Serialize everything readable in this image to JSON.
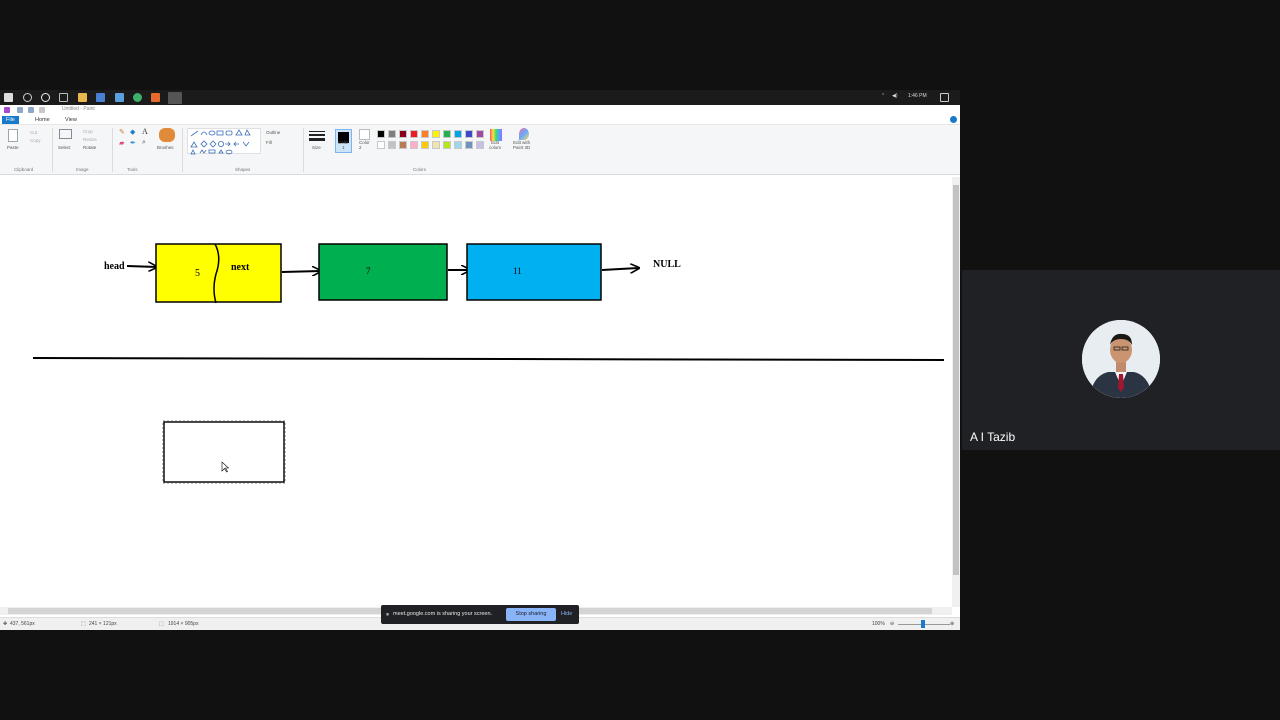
{
  "paint": {
    "window_title": "Untitled - Paint",
    "menu_tabs": [
      "File",
      "Home",
      "View"
    ],
    "clipboard": {
      "paste": "Paste",
      "cut": "Cut",
      "copy": "Copy"
    },
    "image": {
      "select": "Select",
      "crop": "Crop",
      "resize": "Resize",
      "rotate": "Rotate"
    },
    "tools_label": "Tools",
    "brushes_label": "Brushes",
    "shapes": {
      "outline": "Outline",
      "fill": "Fill"
    },
    "size_label": "Size",
    "color1_label": "Color\n1",
    "color2_label": "Color\n2",
    "edit_colors_label": "Edit\ncolors",
    "edit_paint3d_label": "Edit with\nPaint 3D",
    "group_labels": [
      "Clipboard",
      "Image",
      "Tools",
      "Shapes",
      "Colors"
    ],
    "palette_row1": [
      "#000000",
      "#7f7f7f",
      "#880015",
      "#ed1c24",
      "#ff7f27",
      "#fff200",
      "#22b14c",
      "#00a2e8",
      "#3f48cc",
      "#a349a4"
    ],
    "palette_row2": [
      "#ffffff",
      "#c3c3c3",
      "#b97a57",
      "#ffaec9",
      "#ffc90e",
      "#efe4b0",
      "#b5e61d",
      "#99d9ea",
      "#7092be",
      "#c8bfe7"
    ]
  },
  "taskbar": {
    "time": "1:46 PM"
  },
  "status": {
    "cursor_pos": "437, 561px",
    "selection_size": "241 × 121px",
    "image_size": "1914 × 905px",
    "zoom": "100%"
  },
  "diagram": {
    "head_label": "head",
    "null_label": "NULL",
    "nodes": [
      {
        "value": "5",
        "next_label": "next",
        "color": "#ffff00"
      },
      {
        "value": "7",
        "color": "#00b050"
      },
      {
        "value": "11",
        "color": "#00b0f0"
      }
    ]
  },
  "share_banner": {
    "text": "meet.google.com is sharing your screen.",
    "stop_label": "Stop sharing",
    "hide_label": "Hide"
  },
  "participant": {
    "name": "A I Tazib"
  }
}
